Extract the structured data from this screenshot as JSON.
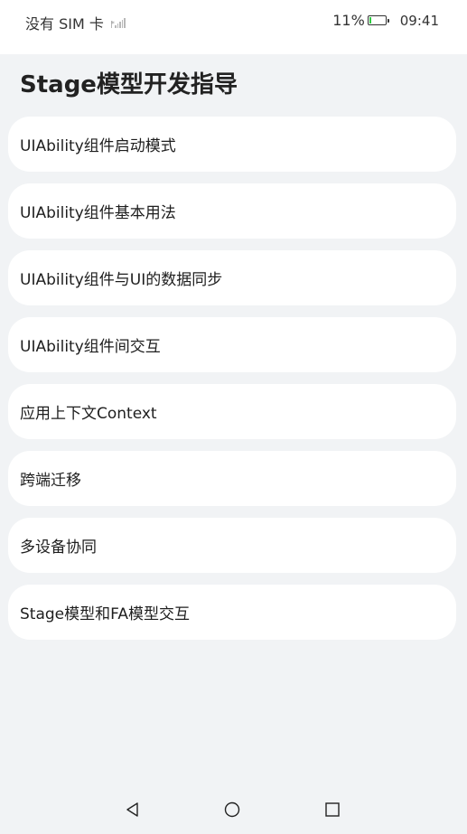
{
  "status_bar": {
    "carrier": "没有 SIM 卡",
    "battery": "11%",
    "battery_level": 0.11,
    "time": "09:41"
  },
  "header": {
    "title": "Stage模型开发指导"
  },
  "menu": {
    "items": [
      {
        "label": "UIAbility组件启动模式"
      },
      {
        "label": "UIAbility组件基本用法"
      },
      {
        "label": "UIAbility组件与UI的数据同步"
      },
      {
        "label": "UIAbility组件间交互"
      },
      {
        "label": "应用上下文Context"
      },
      {
        "label": "跨端迁移"
      },
      {
        "label": "多设备协同"
      },
      {
        "label": "Stage模型和FA模型交互"
      }
    ]
  },
  "nav_bar": {
    "icons": [
      "back-triangle-icon",
      "home-circle-icon",
      "recent-square-icon"
    ]
  }
}
